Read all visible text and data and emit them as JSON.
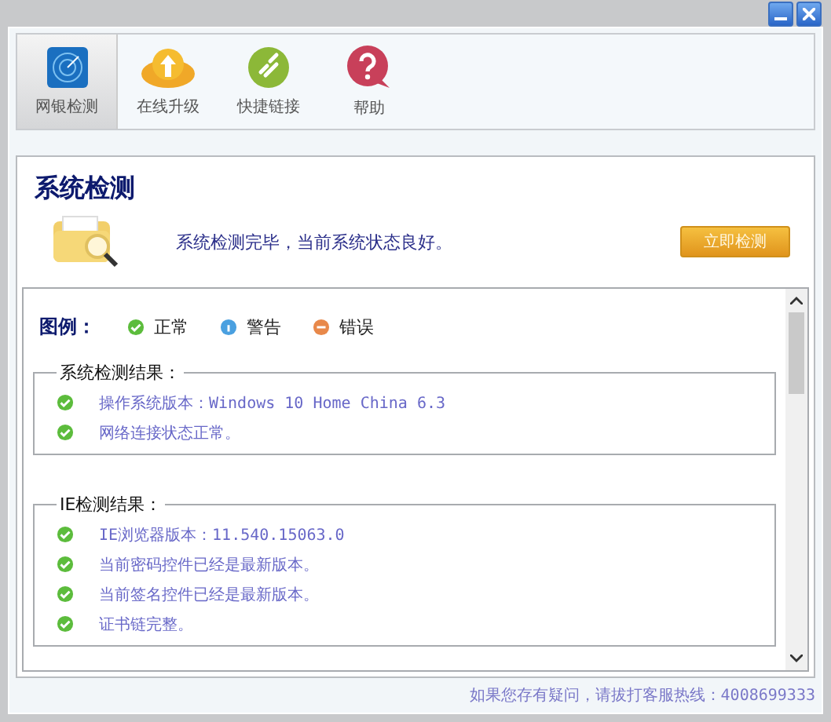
{
  "toolbar": [
    {
      "label": "网银检测",
      "selected": true
    },
    {
      "label": "在线升级",
      "selected": false
    },
    {
      "label": "快捷链接",
      "selected": false
    },
    {
      "label": "帮助",
      "selected": false
    }
  ],
  "panel": {
    "title": "系统检测",
    "message": "系统检测完毕，当前系统状态良好。",
    "button": "立即检测"
  },
  "legend": {
    "label": "图例：",
    "items": [
      {
        "kind": "ok",
        "label": "正常"
      },
      {
        "kind": "info",
        "label": "警告"
      },
      {
        "kind": "error",
        "label": "错误"
      }
    ]
  },
  "groups": [
    {
      "title": "系统检测结果：",
      "items": [
        {
          "kind": "ok",
          "text": "操作系统版本：Windows 10 Home China 6.3"
        },
        {
          "kind": "ok",
          "text": "网络连接状态正常。"
        }
      ]
    },
    {
      "title": "IE检测结果：",
      "items": [
        {
          "kind": "ok",
          "text": "IE浏览器版本：11.540.15063.0"
        },
        {
          "kind": "ok",
          "text": "当前密码控件已经是最新版本。"
        },
        {
          "kind": "ok",
          "text": "当前签名控件已经是最新版本。"
        },
        {
          "kind": "ok",
          "text": "证书链完整。"
        }
      ]
    }
  ],
  "footer": "如果您存有疑问，请拔打客服热线：4008699333"
}
